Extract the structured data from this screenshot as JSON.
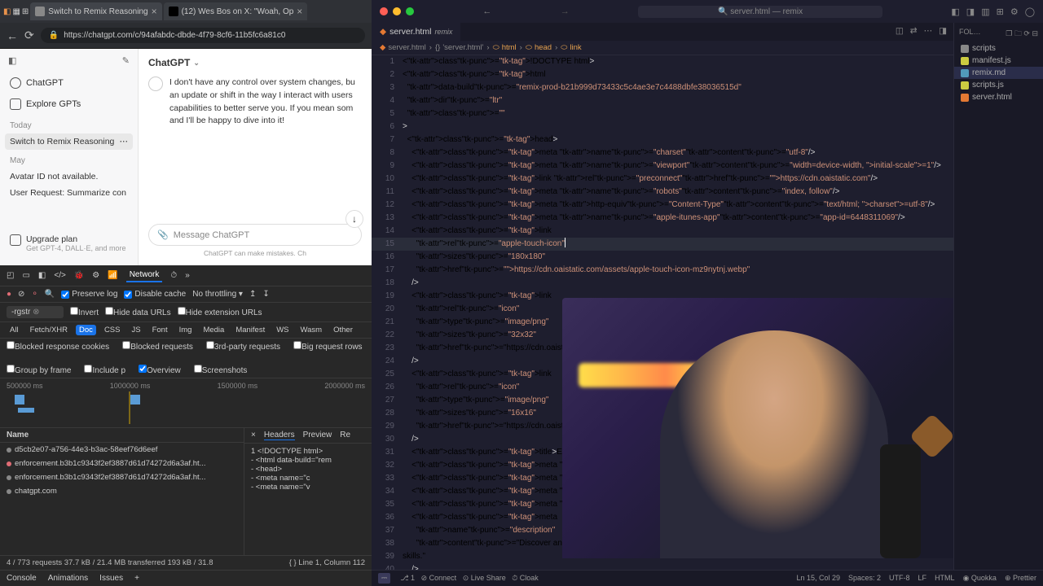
{
  "browser": {
    "tabs": [
      {
        "title": "Switch to Remix Reasoning"
      },
      {
        "title": "(12) Wes Bos on X: \"Woah, Op"
      }
    ],
    "url": "https://chatgpt.com/c/94afabdc-dbde-4f79-8cf6-11b5fc6a81c0"
  },
  "chat": {
    "title": "ChatGPT",
    "sidebar": {
      "items": [
        "ChatGPT",
        "Explore GPTs"
      ],
      "sections": {
        "today_label": "Today",
        "today": [
          {
            "title": "Switch to Remix Reasoning",
            "menu": "⋯"
          }
        ],
        "may_label": "May",
        "may": [
          "Avatar ID not available.",
          "User Request: Summarize con"
        ]
      },
      "upgrade": {
        "title": "Upgrade plan",
        "sub": "Get GPT-4, DALL·E, and more"
      }
    },
    "message": "I don't have any control over system changes, bu an update or shift in the way I interact with users capabilities to better serve you. If you mean som and I'll be happy to dive into it!",
    "input_placeholder": "Message ChatGPT",
    "footer": "ChatGPT can make mistakes. Ch"
  },
  "devtools": {
    "tabs": [
      "Network"
    ],
    "toolbar": {
      "preserve": "Preserve log",
      "disable_cache": "Disable cache",
      "throttling": "No throttling"
    },
    "filter": {
      "value": "-rgstr",
      "invert": "Invert",
      "hide_data": "Hide data URLs",
      "hide_ext": "Hide extension URLs"
    },
    "types": [
      "All",
      "Fetch/XHR",
      "Doc",
      "CSS",
      "JS",
      "Font",
      "Img",
      "Media",
      "Manifest",
      "WS",
      "Wasm",
      "Other"
    ],
    "checks": [
      "Blocked response cookies",
      "Blocked requests",
      "3rd-party requests",
      "Big request rows",
      "Group by frame",
      "Include p",
      "Overview",
      "Screenshots"
    ],
    "timeline_labels": [
      "500000 ms",
      "1000000 ms",
      "1500000 ms",
      "2000000 ms"
    ],
    "name_header": "Name",
    "requests": [
      {
        "name": "d5cb2e07-a756-44e3-b3ac-58eef76d6eef",
        "dot": ""
      },
      {
        "name": "enforcement.b3b1c9343f2ef3887d61d74272d6a3af.ht...",
        "dot": "red"
      },
      {
        "name": "enforcement.b3b1c9343f2ef3887d61d74272d6a3af.ht...",
        "dot": ""
      },
      {
        "name": "chatgpt.com",
        "dot": ""
      }
    ],
    "detail_tabs": [
      "Headers",
      "Preview",
      "Re"
    ],
    "detail_code": [
      "1    <!DOCTYPE html>",
      "-    <html data-build=\"rem",
      "-        <head>",
      "-            <meta name=\"c",
      "-            <meta name=\"v"
    ],
    "status": "4 / 773 requests   37.7 kB / 21.4 MB transferred   193 kB / 31.8",
    "status_right": "{ }   Line 1, Column 112",
    "bottom": [
      "Console",
      "Animations",
      "Issues"
    ]
  },
  "vscode": {
    "title": "server.html — remix",
    "tab": {
      "file": "server.html",
      "modified": "remix"
    },
    "breadcrumbs": [
      "server.html",
      "'server.html'",
      "html",
      "head",
      "link"
    ],
    "code": [
      {
        "n": 1,
        "t": "<!DOCTYPE html>"
      },
      {
        "n": 2,
        "t": "<html"
      },
      {
        "n": 3,
        "t": "  data-build=\"remix-prod-b21b999d73433c5c4ae3e7c4488dbfe38036515d\""
      },
      {
        "n": 4,
        "t": "  dir=\"ltr\""
      },
      {
        "n": 5,
        "t": "  class=\"\""
      },
      {
        "n": 6,
        "t": ">"
      },
      {
        "n": 7,
        "t": "  <head>"
      },
      {
        "n": 8,
        "t": "    <meta name=\"charset\" content=\"utf-8\" />"
      },
      {
        "n": 9,
        "t": "    <meta name=\"viewport\" content=\"width=device-width, initial-scale=1\" />"
      },
      {
        "n": 10,
        "t": "    <link rel=\"preconnect\" href=\"https://cdn.oaistatic.com\" />"
      },
      {
        "n": 11,
        "t": "    <meta name=\"robots\" content=\"index, follow\" />"
      },
      {
        "n": 12,
        "t": "    <meta http-equiv=\"Content-Type\" content=\"text/html; charset=utf-8\" />"
      },
      {
        "n": 13,
        "t": "    <meta name=\"apple-itunes-app\" content=\"app-id=6448311069\" />"
      },
      {
        "n": 14,
        "t": "    <link"
      },
      {
        "n": 15,
        "t": "      rel=\"apple-touch-icon\"",
        "hl": true
      },
      {
        "n": 16,
        "t": "      sizes=\"180x180\""
      },
      {
        "n": 17,
        "t": "      href=\"https://cdn.oaistatic.com/assets/apple-touch-icon-mz9nytnj.webp\""
      },
      {
        "n": 18,
        "t": "    />"
      },
      {
        "n": 19,
        "t": "    <link"
      },
      {
        "n": 20,
        "t": "      rel=\"icon\""
      },
      {
        "n": 21,
        "t": "      type=\"image/png\""
      },
      {
        "n": 22,
        "t": "      sizes=\"32x32\""
      },
      {
        "n": 23,
        "t": "      href=\"https://cdn.oaistatic.co"
      },
      {
        "n": 24,
        "t": "    />"
      },
      {
        "n": 25,
        "t": "    <link"
      },
      {
        "n": 26,
        "t": "      rel=\"icon\""
      },
      {
        "n": 27,
        "t": "      type=\"image/png\""
      },
      {
        "n": 28,
        "t": "      sizes=\"16x16\""
      },
      {
        "n": 29,
        "t": "      href=\"https://cdn.oaistatic.co"
      },
      {
        "n": 30,
        "t": "    />"
      },
      {
        "n": 31,
        "t": "    <title>Explore GPTs</title>"
      },
      {
        "n": 32,
        "t": "    <meta property=\"og:site_name\" co"
      },
      {
        "n": 33,
        "t": "    <meta property=\"og:type\" content"
      },
      {
        "n": 34,
        "t": "    <meta property=\"og:title\" conten"
      },
      {
        "n": 35,
        "t": "    <meta property=\"og:url\" content="
      },
      {
        "n": 36,
        "t": "    <meta"
      },
      {
        "n": 37,
        "t": "      name=\"description\""
      },
      {
        "n": 38,
        "t": "      content=\"Discover and create c"
      },
      {
        "n": 39,
        "t": "skills.\""
      },
      {
        "n": 40,
        "t": "    />"
      }
    ],
    "explorer": {
      "label": "FOL…",
      "files": [
        {
          "name": "scripts",
          "color": "#888"
        },
        {
          "name": "manifest.js",
          "color": "#cbcb41"
        },
        {
          "name": "remix.md",
          "color": "#519aba",
          "sel": true
        },
        {
          "name": "scripts.js",
          "color": "#cbcb41"
        },
        {
          "name": "server.html",
          "color": "#e37933"
        }
      ]
    },
    "status": {
      "left": [
        "⎇ 1",
        "⊘ Connect",
        "⊙ Live Share",
        "⏱ Cloak"
      ],
      "right": [
        "Ln 15, Col 29",
        "Spaces: 2",
        "UTF-8",
        "LF",
        "HTML",
        "◉ Quokka",
        "⊕ Prettier"
      ]
    }
  }
}
